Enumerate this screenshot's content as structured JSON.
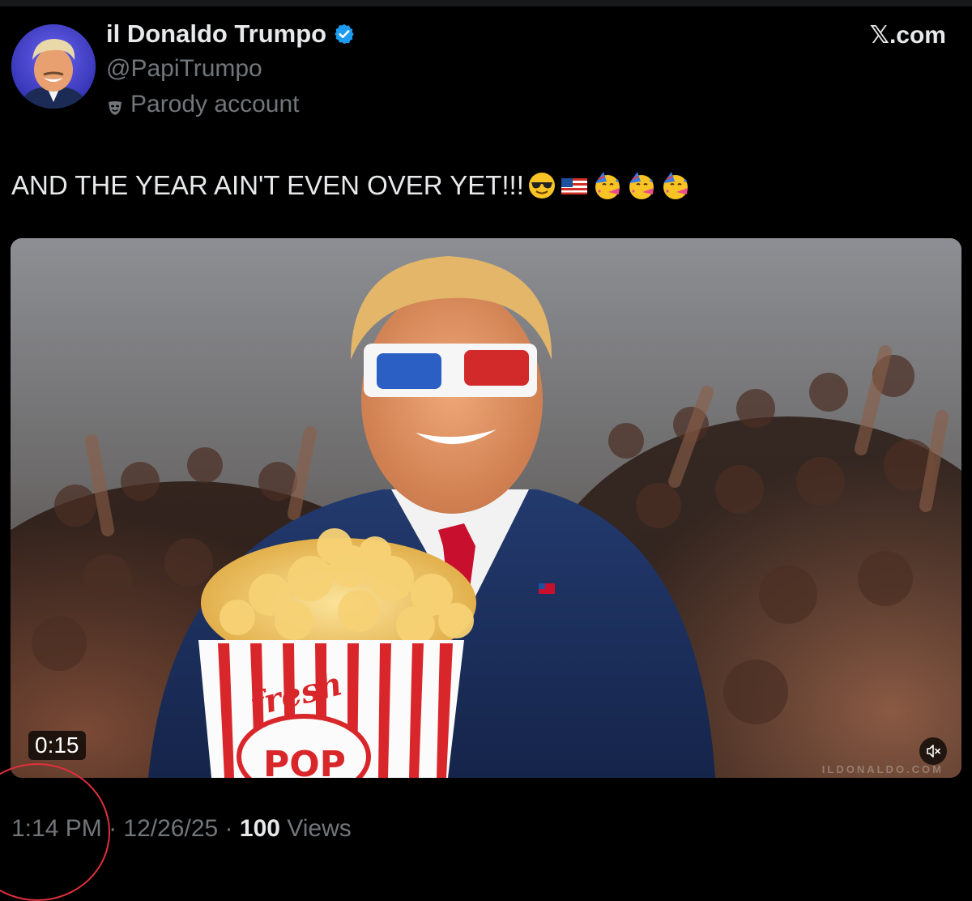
{
  "author": {
    "display_name": "il Donaldo Trumpo",
    "handle": "@PapiTrumpo",
    "label": "Parody account",
    "verified": true
  },
  "brand": "𝕏.com",
  "tweet": {
    "text": "AND THE YEAR AIN'T EVEN OVER YET!!!",
    "emojis": [
      "smiling-face-with-sunglasses",
      "flag-united-states",
      "partying-face",
      "partying-face",
      "partying-face"
    ]
  },
  "media": {
    "duration": "0:15",
    "watermark": "ILDONALDO.COM",
    "popcorn_box_text": [
      "fresh",
      "POP"
    ]
  },
  "meta": {
    "time": "1:14 PM",
    "separator": "·",
    "date": "12/26/25",
    "views_count": "100",
    "views_label": "Views"
  },
  "colors": {
    "background": "#000000",
    "primary_text": "#e7e9ea",
    "secondary_text": "#71767b",
    "verified_badge": "#1d9bf0",
    "annotation": "#e0303c"
  }
}
